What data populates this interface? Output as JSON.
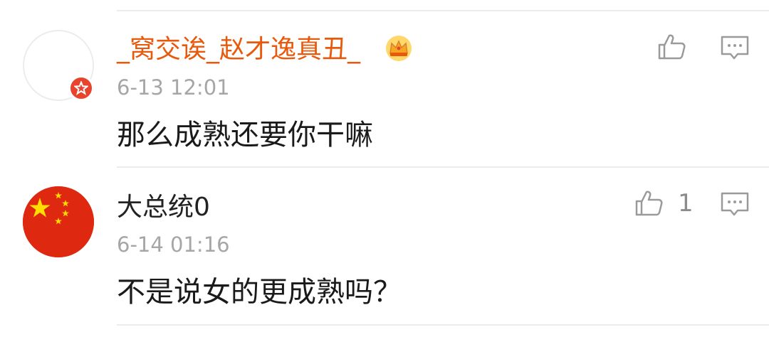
{
  "comments": [
    {
      "username": "_窝交诶_赵才逸真丑_",
      "timestamp": "6-13 12:01",
      "text": "那么成熟还要你干嘛",
      "like_count": ""
    },
    {
      "username": "大总统0",
      "timestamp": "6-14 01:16",
      "text": "不是说女的更成熟吗？",
      "like_count": "1"
    }
  ],
  "colors": {
    "vip_name": "#e8590c",
    "badge": "#e8442d",
    "flag_red": "#de2910",
    "flag_star": "#ffde00",
    "icon_gray": "#9a9a9a"
  },
  "icons": {
    "like": "thumbs-up-icon",
    "reply": "comment-icon",
    "vip": "crown-icon",
    "verified": "star-badge-icon"
  }
}
